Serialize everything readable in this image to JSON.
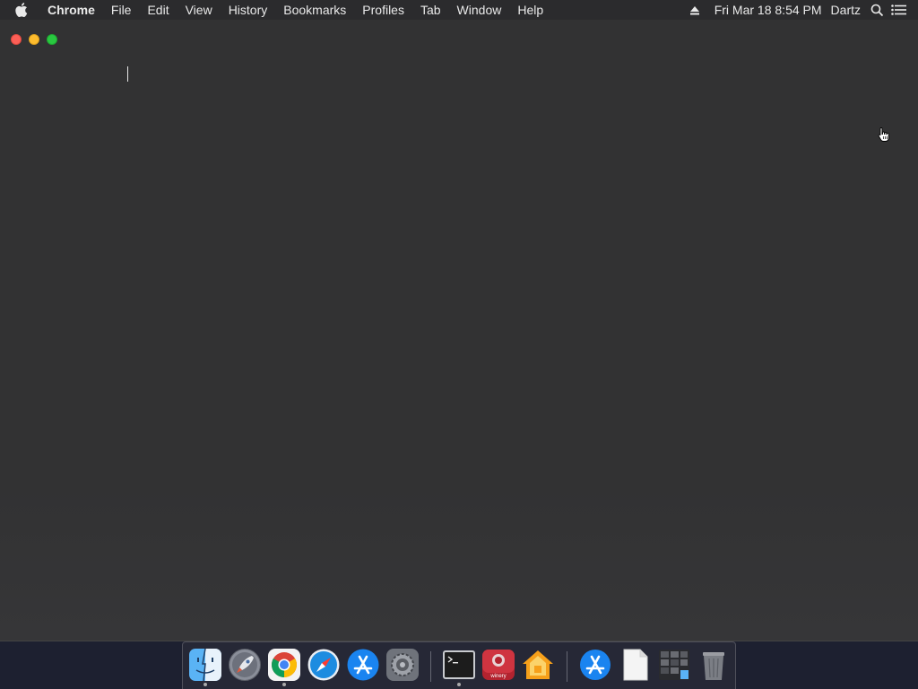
{
  "menubar": {
    "app_name": "Chrome",
    "items": [
      "File",
      "Edit",
      "View",
      "History",
      "Bookmarks",
      "Profiles",
      "Tab",
      "Window",
      "Help"
    ],
    "datetime": "Fri Mar 18  8:54 PM",
    "user": "Dartz",
    "icons": [
      "apple-icon",
      "eject-icon",
      "spotlight-search-icon",
      "notification-center-icon"
    ]
  },
  "window": {
    "controls": [
      "close-button",
      "minimize-button",
      "zoom-button"
    ]
  },
  "dock": {
    "apps": [
      {
        "name": "finder",
        "running": true
      },
      {
        "name": "launchpad",
        "running": false
      },
      {
        "name": "chrome",
        "running": true
      },
      {
        "name": "safari",
        "running": false
      },
      {
        "name": "app-store",
        "running": false
      },
      {
        "name": "system-preferences",
        "running": false
      },
      {
        "name": "terminal",
        "running": true
      },
      {
        "name": "winery",
        "running": false,
        "label": "winery"
      },
      {
        "name": "home",
        "running": false
      },
      {
        "name": "app-store-folder",
        "running": false
      },
      {
        "name": "document",
        "running": false
      },
      {
        "name": "screenshots-folder",
        "running": false
      },
      {
        "name": "trash",
        "running": false
      }
    ]
  }
}
